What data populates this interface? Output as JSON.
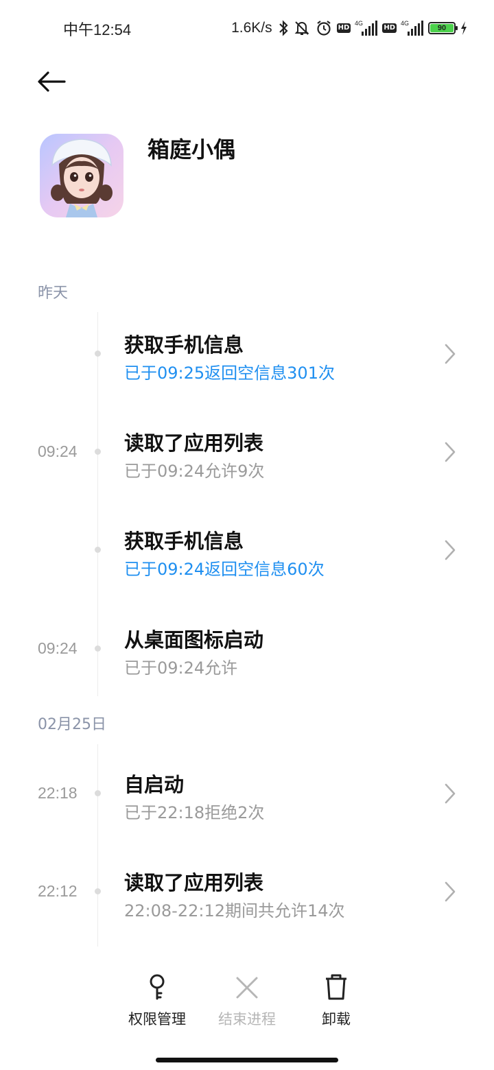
{
  "status_bar": {
    "time": "中午12:54",
    "net_speed": "1.6K/s",
    "hd1": "HD",
    "hd2": "HD",
    "net_type1": "4G",
    "net_type2": "4G",
    "battery": "90",
    "battery_color": "#4cd14c"
  },
  "app": {
    "name": "箱庭小偶"
  },
  "sections": [
    {
      "label": "昨天"
    },
    {
      "label": "02月25日"
    }
  ],
  "rows": [
    {
      "time": "",
      "title": "获取手机信息",
      "subtitle": "已于09:25返回空信息301次",
      "highlight": true,
      "chevron": true
    },
    {
      "time": "09:24",
      "title": "读取了应用列表",
      "subtitle": "已于09:24允许9次",
      "highlight": false,
      "chevron": true
    },
    {
      "time": "",
      "title": "获取手机信息",
      "subtitle": "已于09:24返回空信息60次",
      "highlight": true,
      "chevron": true
    },
    {
      "time": "09:24",
      "title": "从桌面图标启动",
      "subtitle": "已于09:24允许",
      "highlight": false,
      "chevron": false
    },
    {
      "time": "22:18",
      "title": "自启动",
      "subtitle": "已于22:18拒绝2次",
      "highlight": false,
      "chevron": true
    },
    {
      "time": "22:12",
      "title": "读取了应用列表",
      "subtitle": "22:08-22:12期间共允许14次",
      "highlight": false,
      "chevron": true
    }
  ],
  "bottom_bar": {
    "permissions_label": "权限管理",
    "end_process_label": "结束进程",
    "uninstall_label": "卸载"
  },
  "colors": {
    "highlight": "#1f8ff0",
    "muted": "#9a9a9a",
    "section": "#8a93a8"
  }
}
